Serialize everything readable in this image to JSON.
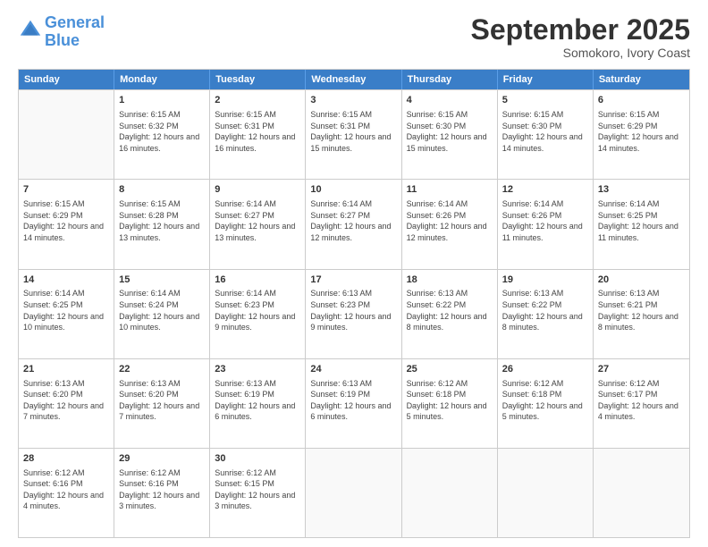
{
  "header": {
    "logo_line1": "General",
    "logo_line2": "Blue",
    "month": "September 2025",
    "location": "Somokoro, Ivory Coast"
  },
  "weekdays": [
    "Sunday",
    "Monday",
    "Tuesday",
    "Wednesday",
    "Thursday",
    "Friday",
    "Saturday"
  ],
  "rows": [
    [
      {
        "day": "",
        "empty": true
      },
      {
        "day": "1",
        "sunrise": "6:15 AM",
        "sunset": "6:32 PM",
        "daylight": "12 hours and 16 minutes."
      },
      {
        "day": "2",
        "sunrise": "6:15 AM",
        "sunset": "6:31 PM",
        "daylight": "12 hours and 16 minutes."
      },
      {
        "day": "3",
        "sunrise": "6:15 AM",
        "sunset": "6:31 PM",
        "daylight": "12 hours and 15 minutes."
      },
      {
        "day": "4",
        "sunrise": "6:15 AM",
        "sunset": "6:30 PM",
        "daylight": "12 hours and 15 minutes."
      },
      {
        "day": "5",
        "sunrise": "6:15 AM",
        "sunset": "6:30 PM",
        "daylight": "12 hours and 14 minutes."
      },
      {
        "day": "6",
        "sunrise": "6:15 AM",
        "sunset": "6:29 PM",
        "daylight": "12 hours and 14 minutes."
      }
    ],
    [
      {
        "day": "7",
        "sunrise": "6:15 AM",
        "sunset": "6:29 PM",
        "daylight": "12 hours and 14 minutes."
      },
      {
        "day": "8",
        "sunrise": "6:15 AM",
        "sunset": "6:28 PM",
        "daylight": "12 hours and 13 minutes."
      },
      {
        "day": "9",
        "sunrise": "6:14 AM",
        "sunset": "6:27 PM",
        "daylight": "12 hours and 13 minutes."
      },
      {
        "day": "10",
        "sunrise": "6:14 AM",
        "sunset": "6:27 PM",
        "daylight": "12 hours and 12 minutes."
      },
      {
        "day": "11",
        "sunrise": "6:14 AM",
        "sunset": "6:26 PM",
        "daylight": "12 hours and 12 minutes."
      },
      {
        "day": "12",
        "sunrise": "6:14 AM",
        "sunset": "6:26 PM",
        "daylight": "12 hours and 11 minutes."
      },
      {
        "day": "13",
        "sunrise": "6:14 AM",
        "sunset": "6:25 PM",
        "daylight": "12 hours and 11 minutes."
      }
    ],
    [
      {
        "day": "14",
        "sunrise": "6:14 AM",
        "sunset": "6:25 PM",
        "daylight": "12 hours and 10 minutes."
      },
      {
        "day": "15",
        "sunrise": "6:14 AM",
        "sunset": "6:24 PM",
        "daylight": "12 hours and 10 minutes."
      },
      {
        "day": "16",
        "sunrise": "6:14 AM",
        "sunset": "6:23 PM",
        "daylight": "12 hours and 9 minutes."
      },
      {
        "day": "17",
        "sunrise": "6:13 AM",
        "sunset": "6:23 PM",
        "daylight": "12 hours and 9 minutes."
      },
      {
        "day": "18",
        "sunrise": "6:13 AM",
        "sunset": "6:22 PM",
        "daylight": "12 hours and 8 minutes."
      },
      {
        "day": "19",
        "sunrise": "6:13 AM",
        "sunset": "6:22 PM",
        "daylight": "12 hours and 8 minutes."
      },
      {
        "day": "20",
        "sunrise": "6:13 AM",
        "sunset": "6:21 PM",
        "daylight": "12 hours and 8 minutes."
      }
    ],
    [
      {
        "day": "21",
        "sunrise": "6:13 AM",
        "sunset": "6:20 PM",
        "daylight": "12 hours and 7 minutes."
      },
      {
        "day": "22",
        "sunrise": "6:13 AM",
        "sunset": "6:20 PM",
        "daylight": "12 hours and 7 minutes."
      },
      {
        "day": "23",
        "sunrise": "6:13 AM",
        "sunset": "6:19 PM",
        "daylight": "12 hours and 6 minutes."
      },
      {
        "day": "24",
        "sunrise": "6:13 AM",
        "sunset": "6:19 PM",
        "daylight": "12 hours and 6 minutes."
      },
      {
        "day": "25",
        "sunrise": "6:12 AM",
        "sunset": "6:18 PM",
        "daylight": "12 hours and 5 minutes."
      },
      {
        "day": "26",
        "sunrise": "6:12 AM",
        "sunset": "6:18 PM",
        "daylight": "12 hours and 5 minutes."
      },
      {
        "day": "27",
        "sunrise": "6:12 AM",
        "sunset": "6:17 PM",
        "daylight": "12 hours and 4 minutes."
      }
    ],
    [
      {
        "day": "28",
        "sunrise": "6:12 AM",
        "sunset": "6:16 PM",
        "daylight": "12 hours and 4 minutes."
      },
      {
        "day": "29",
        "sunrise": "6:12 AM",
        "sunset": "6:16 PM",
        "daylight": "12 hours and 3 minutes."
      },
      {
        "day": "30",
        "sunrise": "6:12 AM",
        "sunset": "6:15 PM",
        "daylight": "12 hours and 3 minutes."
      },
      {
        "day": "",
        "empty": true
      },
      {
        "day": "",
        "empty": true
      },
      {
        "day": "",
        "empty": true
      },
      {
        "day": "",
        "empty": true
      }
    ]
  ]
}
